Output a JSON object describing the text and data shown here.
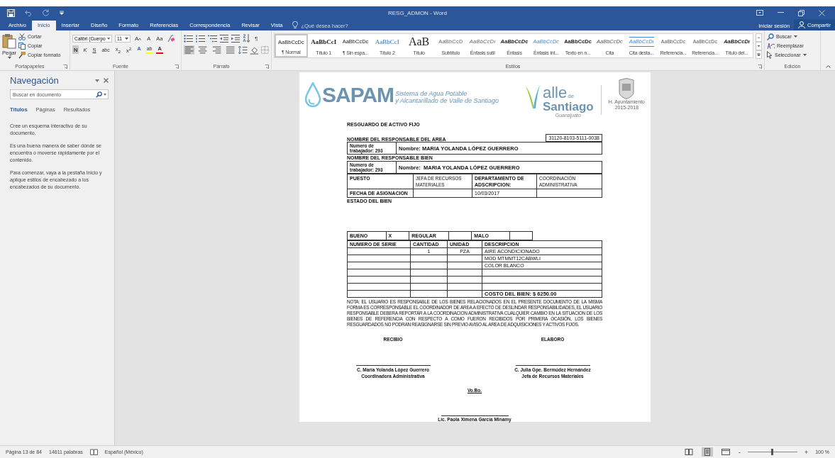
{
  "title_bar": {
    "title": "RESG_ADMON - Word"
  },
  "tabs": [
    {
      "label": "Archivo",
      "selected": false
    },
    {
      "label": "Inicio",
      "selected": true
    },
    {
      "label": "Insertar",
      "selected": false
    },
    {
      "label": "Diseño",
      "selected": false
    },
    {
      "label": "Formato",
      "selected": false
    },
    {
      "label": "Referencias",
      "selected": false
    },
    {
      "label": "Correspondencia",
      "selected": false
    },
    {
      "label": "Revisar",
      "selected": false
    },
    {
      "label": "Vista",
      "selected": false
    }
  ],
  "tell_me": {
    "placeholder": "¿Qué desea hacer?"
  },
  "account": {
    "sign_in": "Iniciar sesión",
    "share": "Compartir"
  },
  "clipboard": {
    "paste": "Pegar",
    "cut": "Cortar",
    "copy": "Copiar",
    "format_painter": "Copiar formato",
    "label": "Portapapeles"
  },
  "font": {
    "family": "Calibri (Cuerpo",
    "size": "11",
    "grow": "A",
    "shrink": "A",
    "case": "Aa",
    "label": "Fuente",
    "format_buttons": [
      {
        "label": "N",
        "kind": "bold",
        "selected": true
      },
      {
        "label": "K",
        "kind": "italic",
        "selected": false
      },
      {
        "label": "S",
        "kind": "underline",
        "selected": false
      },
      {
        "label": "abc",
        "kind": "strike",
        "selected": false
      },
      {
        "label": "x$_{2}$",
        "kind": "sub",
        "selected": false
      },
      {
        "label": "x$^{2}$",
        "kind": "sup",
        "selected": false
      }
    ],
    "color_buttons": [
      {
        "label": "A",
        "kind": "effects"
      },
      {
        "label": "ab",
        "kind": "highlight",
        "color": "#ffff00"
      },
      {
        "label": "A",
        "kind": "color",
        "color": "#ff0000"
      }
    ]
  },
  "paragraph": {
    "pilcrow": "¶",
    "label": "Párrafo",
    "align": [
      {
        "kind": "left",
        "selected": true
      },
      {
        "kind": "center",
        "selected": false
      },
      {
        "kind": "right",
        "selected": false
      },
      {
        "kind": "justify",
        "selected": false
      }
    ]
  },
  "styles": {
    "label": "Estilos",
    "items": [
      {
        "preview": "AaBbCcDc",
        "name": "¶ Normal",
        "kind": "plain",
        "selected": true
      },
      {
        "preview": "AaBbCcI",
        "name": "Título 1",
        "kind": "strong-serif",
        "selected": false
      },
      {
        "preview": "AaBbCcDc",
        "name": "¶ Sin espa...",
        "kind": "plain",
        "selected": false
      },
      {
        "preview": "AaBbCcI",
        "name": "Título 2",
        "kind": "accent-large",
        "selected": false
      },
      {
        "preview": "AaB",
        "name": "Título",
        "kind": "title",
        "selected": false
      },
      {
        "preview": "AaBbCcD",
        "name": "Subtítulo",
        "kind": "subtle",
        "selected": false
      },
      {
        "preview": "AaBbCcDı",
        "name": "Énfasis sutil",
        "kind": "subtle-italic",
        "selected": false
      },
      {
        "preview": "AaBbCcDc",
        "name": "Énfasis",
        "kind": "italic-bold",
        "selected": false
      },
      {
        "preview": "AaBbCcDc",
        "name": "Énfasis int...",
        "kind": "accent-italic",
        "selected": false
      },
      {
        "preview": "AaBbCcDc",
        "name": "Texto en n...",
        "kind": "bold",
        "selected": false
      },
      {
        "preview": "AaBbCcDc",
        "name": "Cita",
        "kind": "italic",
        "selected": false
      },
      {
        "preview": "AaBbCcDı",
        "name": "Cita desta...",
        "kind": "accent-underline",
        "selected": false
      },
      {
        "preview": "AaBbCcDc",
        "name": "Referencia...",
        "kind": "smallcaps",
        "selected": false
      },
      {
        "preview": "AaBbCcDc",
        "name": "Referencia...",
        "kind": "accent-smallcaps",
        "selected": false
      },
      {
        "preview": "AaBbCcDı",
        "name": "Título del...",
        "kind": "bold-italic",
        "selected": false
      }
    ]
  },
  "editing": {
    "find": "Buscar",
    "replace": "Reemplazar",
    "select": "Seleccionar",
    "label": "Edición"
  },
  "navigation": {
    "title": "Navegación",
    "search": {
      "placeholder": "Buscar en documento"
    },
    "tabs": [
      {
        "label": "Títulos",
        "selected": true
      },
      {
        "label": "Páginas",
        "selected": false
      },
      {
        "label": "Resultados",
        "selected": false
      }
    ],
    "paragraphs": [
      "Cree un esquema interactivo de su documento.",
      "Es una buena manera de saber dónde se encuentra o moverse rápidamente por el contenido.",
      "Para comenzar, vaya a la pestaña Inicio y aplique estilos de encabezado a los encabezados de su documento."
    ]
  },
  "document": {
    "logo": {
      "name": "SAPAM",
      "line1": "Sistema de Agua Potable",
      "line2": "y Alcantarillado de Valle de Santiago"
    },
    "city_logo": {
      "word": "alle",
      "small": "de",
      "city": "Santiago",
      "state": "Guanajuato"
    },
    "seal": {
      "caption": "H. Ayuntamiento",
      "years": "2015-2018"
    },
    "form_title": "RESGUARDO DE ACTIVO FIJO",
    "area_heading": "NOMBRE DEL RESPONSABLE DEL AREA",
    "account_code": "31120-8103-5111-0038",
    "area_worker": {
      "number": "Numero de trabajador: 293",
      "name": "Nombre: MARIA YOLANDA LÓPEZ GUERRERO"
    },
    "asset_heading": "NOMBRE DEL RESPONSABLE BIEN",
    "asset_worker": {
      "number": "Numero de trabajador: 293",
      "name": "Nombre:  MARIA YOLANDA LÓPEZ GUERRERO"
    },
    "details": [
      {
        "cells": [
          {
            "text": "PUESTO",
            "bold": true
          },
          {
            "text": "JEFA DE RECURSOS MATERIALES",
            "bold": false
          },
          {
            "text": "DEPARTAMENTO DE ADSCRIPCION:",
            "bold": true
          },
          {
            "text": "COORDINACIÓN ADMINISTRATIVA",
            "bold": false
          }
        ]
      },
      {
        "cells": [
          {
            "text": "FECHA DE ASIGNACION",
            "bold": true
          },
          {},
          {
            "text": "10/03/2017",
            "bold": false
          },
          {}
        ]
      }
    ],
    "condition_heading": "ESTADO DEL BIEN",
    "condition": [
      {
        "label": "BUENO",
        "mark": "X"
      },
      {
        "label": "REGULAR"
      },
      {
        "label": "MALO"
      }
    ],
    "columns": [
      "NUMERO DE SERIE",
      "CANTIDAD",
      "UNIDAD",
      "DESCRIPCION"
    ],
    "rows": [
      {
        "kind": "item",
        "quantity": "1",
        "unit": "PZA",
        "description": "AIRE ACONDICIONADO"
      },
      {
        "kind": "item",
        "description": "MOD MTMMT12CABWLI"
      },
      {
        "kind": "item",
        "description": "COLOR BLANCO"
      },
      {
        "kind": "blank"
      },
      {
        "kind": "blank"
      },
      {
        "kind": "blank"
      },
      {
        "kind": "total",
        "description": "COSTO DEL BIEN: $ 6250.00"
      }
    ],
    "note": "NOTA: EL USUARIO ES RESPONSABLE DE LOS BIENES RELACIONADOS EN EL PRESENTE DOCUMENTO DE LA MISMA FORMA ES CORRESPONSABLE EL COORDINADOR DE AREA A EFECTO DE DESLINDAR RESPONSABILIDADES, EL USUARIO RESPONSABLE DEBERA REPORTAR A LA COORDINACION ADMINISTRATIVA CUALQUIER CAMBIO EN LA SITUACION DE LOS BIENES DE REFERENCIA CON RESPECTO A COMO FUERON RECIBIDOS POR PRIMERA OCASIÓN, LOS BIENES RESGUARDADOS NO PODRAN REASIGNARSE SIN PREVIO AVISO AL AREA DE ADQUISICIONES Y ACTIVOS FIJOS.",
    "signatures": [
      {
        "role": "RECIBIO",
        "name": "C. María Yolanda López Guerrero",
        "position": "Coordinadora Administrativa"
      },
      {
        "role": "ELABORO",
        "name": "C. Julia Gpe. Bermúdez Hernández",
        "position": "Jefa de Recursos Materiales"
      }
    ],
    "approval": {
      "label": "Vo.Bo.",
      "name": "Lic. Paola Ximena García Minamy"
    }
  },
  "status_bar": {
    "page": "Página 13 de 84",
    "words": "14611 palabras",
    "language": "Español (México)",
    "minus": "-",
    "plus": "+",
    "zoom": "100 %",
    "zoom_slider": {
      "level": 0.5
    },
    "views": [
      {
        "kind": "read",
        "selected": false
      },
      {
        "kind": "print",
        "selected": true
      },
      {
        "kind": "web",
        "selected": false
      }
    ]
  }
}
